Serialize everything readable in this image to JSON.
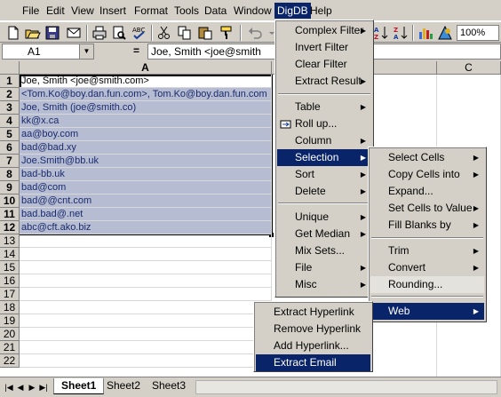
{
  "menubar": {
    "items": [
      "File",
      "Edit",
      "View",
      "Insert",
      "Format",
      "Tools",
      "Data",
      "Window",
      "DigDB",
      "Help"
    ],
    "active": "DigDB"
  },
  "toolbar": {
    "zoom": "100%",
    "icons": [
      "new-icon",
      "open-icon",
      "save-icon",
      "mail-icon",
      "print-icon",
      "print-preview-icon",
      "spelling-icon",
      "cut-icon",
      "copy-icon",
      "paste-icon",
      "format-painter-icon",
      "undo-icon",
      "sort-ascending-icon",
      "sort-descending-icon",
      "chart-wizard-icon",
      "drawing-icon"
    ]
  },
  "formula_bar": {
    "name_box": "A1",
    "equals": "=",
    "content": "Joe, Smith <joe@smith"
  },
  "columns": [
    "A",
    "B",
    "C"
  ],
  "rows": [
    "1",
    "2",
    "3",
    "4",
    "5",
    "6",
    "7",
    "8",
    "9",
    "10",
    "11",
    "12",
    "13",
    "14",
    "15",
    "16",
    "17",
    "18",
    "19",
    "20",
    "21",
    "22"
  ],
  "cells": [
    "Joe, Smith <joe@smith.com>",
    "<Tom.Ko@boy.dan.fun.com>, Tom.Ko@boy.dan.fun.com",
    "Joe, Smith  (joe@smith.co)",
    "kk@x.ca",
    "aa@boy.com",
    "bad@bad.xy",
    "Joe.Smith@bb.uk",
    "bad-bb.uk",
    "bad@com",
    "bad@@cnt.com",
    "bad.bad@.net",
    "abc@cft.ako.biz"
  ],
  "sheet_tabs": [
    "Sheet1",
    "Sheet2",
    "Sheet3"
  ],
  "active_sheet": "Sheet1",
  "digdb_menu": {
    "group1": [
      "Complex Filter",
      "Invert Filter",
      "Clear Filter",
      "Extract Result"
    ],
    "group2": [
      "Table",
      "Roll up...",
      "Column",
      "Selection",
      "Sort",
      "Delete"
    ],
    "group3": [
      "Unique",
      "Get Median",
      "Mix Sets...",
      "File",
      "Misc"
    ],
    "highlighted": "Selection"
  },
  "selection_menu": {
    "group1": [
      "Select Cells",
      "Copy Cells into",
      "Expand...",
      "Set Cells to Value",
      "Fill Blanks by"
    ],
    "group2": [
      "Trim",
      "Convert",
      "Rounding..."
    ],
    "group3": [
      "Web"
    ],
    "highlighted": "Web"
  },
  "web_menu": {
    "items": [
      "Extract Hyperlink",
      "Remove Hyperlink",
      "Add Hyperlink...",
      "Extract Email"
    ],
    "highlighted": "Extract Email"
  },
  "colors": {
    "menu_highlight": "#0a246a",
    "selection_fill": "#b6bdd2",
    "chrome": "#d4d0c8"
  }
}
